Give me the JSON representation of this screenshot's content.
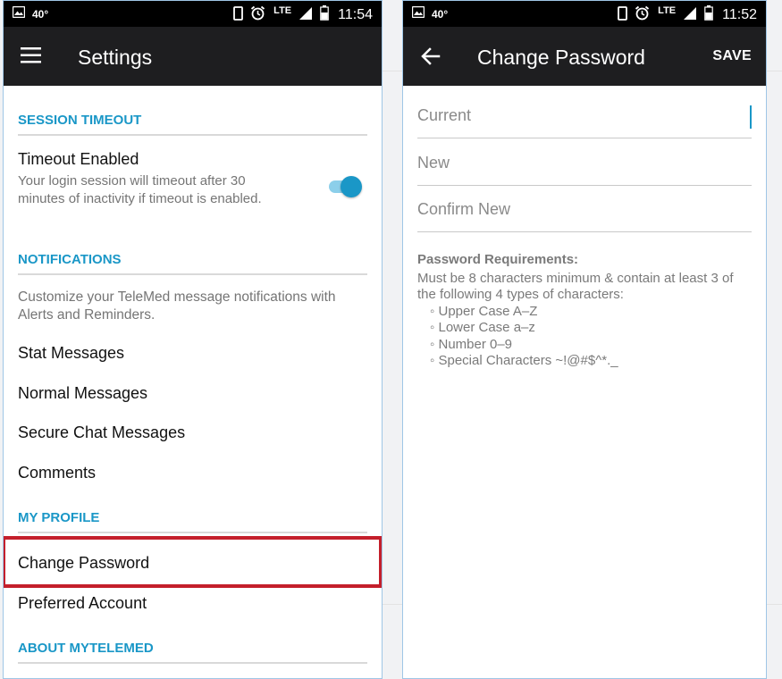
{
  "left_screen": {
    "status_bar": {
      "temperature": "40°",
      "network": "LTE",
      "time": "11:54"
    },
    "app_bar": {
      "menu_icon": "hamburger-menu-icon",
      "title": "Settings"
    },
    "sections": {
      "session_timeout": {
        "header": "SESSION TIMEOUT",
        "timeout_title": "Timeout Enabled",
        "timeout_desc": "Your login session will timeout after 30 minutes of inactivity if timeout is enabled.",
        "toggle_on": true
      },
      "notifications": {
        "header": "NOTIFICATIONS",
        "desc": "Customize your TeleMed message notifications with Alerts and Reminders.",
        "items": [
          "Stat Messages",
          "Normal Messages",
          "Secure Chat Messages",
          "Comments"
        ]
      },
      "my_profile": {
        "header": "MY PROFILE",
        "items": [
          "Change Password",
          "Preferred Account"
        ]
      },
      "about": {
        "header": "ABOUT MYTELEMED"
      }
    }
  },
  "right_screen": {
    "status_bar": {
      "temperature": "40°",
      "network": "LTE",
      "time": "11:52"
    },
    "app_bar": {
      "back_icon": "arrow-back-icon",
      "title": "Change Password",
      "save_label": "SAVE"
    },
    "fields": {
      "current": {
        "placeholder": "Current",
        "value": ""
      },
      "new": {
        "placeholder": "New",
        "value": ""
      },
      "confirm": {
        "placeholder": "Confirm New",
        "value": ""
      }
    },
    "requirements": {
      "title": "Password Requirements:",
      "intro": "Must be 8 characters minimum & contain at least 3 of the following 4 types of characters:",
      "items": [
        "◦ Upper Case A–Z",
        "◦ Lower Case a–z",
        "◦ Number 0–9",
        "◦ Special Characters ~!@#$^*._"
      ]
    }
  },
  "colors": {
    "accent": "#1a97c7",
    "appbar": "#1e1e20",
    "highlight": "#c41f2b"
  }
}
